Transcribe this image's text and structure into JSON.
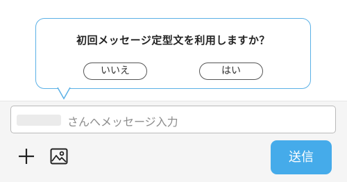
{
  "prompt": {
    "question": "初回メッセージ定型文を利用しますか？",
    "no_label": "いいえ",
    "yes_label": "はい"
  },
  "composer": {
    "placeholder": "さんへメッセージ入力",
    "send_label": "送信",
    "add_icon": "plus-icon",
    "image_icon": "image-icon"
  },
  "colors": {
    "accent": "#45abea",
    "bubble_border": "#5ab0e6",
    "composer_bg": "#f5f5f5"
  }
}
